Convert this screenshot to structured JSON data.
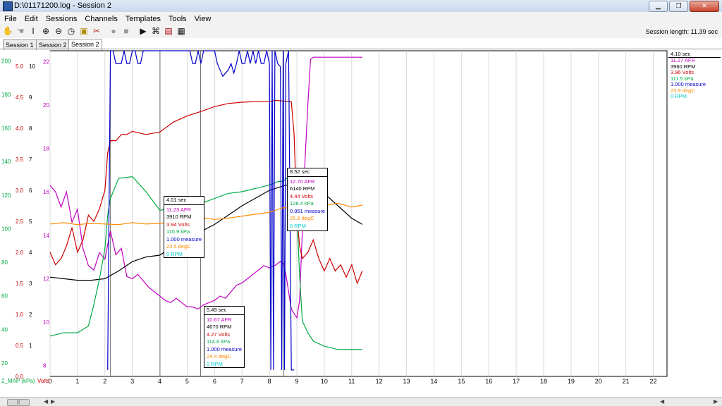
{
  "window": {
    "title": "D:\\01171200.log - Session 2",
    "minimize": "▁",
    "maximize": "❐",
    "close": "✕"
  },
  "menu": [
    "File",
    "Edit",
    "Sessions",
    "Channels",
    "Templates",
    "Tools",
    "View"
  ],
  "toolbar_icons": [
    "hand-icon",
    "pan-icon",
    "cursor-icon",
    "zoom-in-icon",
    "zoom-out-icon",
    "clock-icon",
    "marker-icon",
    "mark-clear-icon",
    "record-icon",
    "stop-icon",
    "play-icon",
    "binoculars-icon",
    "chart-icon",
    "table-icon"
  ],
  "session_length": "Session length:  11.39 sec",
  "tabs": [
    "Session 1",
    "Session 2",
    "Session 2"
  ],
  "colors": {
    "afr": "#c000c0",
    "rpm": "#000000",
    "volts": "#cc0000",
    "kpa": "#00aa44",
    "measure": "#0000cc",
    "degc": "#ff8800",
    "rpm2": "#00c8c8"
  },
  "axes": {
    "x_ticks": [
      "0",
      "1",
      "2",
      "3",
      "4",
      "5",
      "6",
      "7",
      "8",
      "9",
      "10",
      "11",
      "12",
      "13",
      "14",
      "15",
      "16",
      "17",
      "18",
      "19",
      "20",
      "21",
      "22"
    ],
    "map_ticks": [
      "200",
      "180",
      "160",
      "140",
      "120",
      "100",
      "80",
      "60",
      "40",
      "20"
    ],
    "volts_ticks": [
      "5.0",
      "4.5",
      "4.0",
      "3.5",
      "3.0",
      "2.5",
      "2.0",
      "1.5",
      "1.0",
      "0.5",
      "0.0"
    ],
    "rpm_ticks": [
      "10",
      "9",
      "8",
      "7",
      "6",
      "5",
      "4",
      "3",
      "2",
      "1"
    ],
    "afr_ticks": [
      "22",
      "20",
      "18",
      "16",
      "14",
      "12",
      "10",
      "8"
    ],
    "bottom_label_map": "2_MAP (kPa)",
    "bottom_label_volts": "Volts"
  },
  "boxes": [
    {
      "time": "4.01 sec",
      "rows": [
        "11.23 AFR",
        "3910 RPM",
        "3.94 Volts",
        "110.9 kPa",
        "1.000 measure",
        "23.5 degC",
        "0 RPM"
      ]
    },
    {
      "time": "5.49 sec",
      "rows": [
        "10.67 AFR",
        "4670 RPM",
        "4.27 Volts",
        "114.6 kPa",
        "1.000 measure",
        "24.4 degC",
        "0 RPM"
      ]
    },
    {
      "time": "8.52 sec",
      "rows": [
        "12.70 AFR",
        "6140 RPM",
        "4.44 Volts",
        "128.4 kPa",
        "0.951 measure",
        "25.9 degC",
        "0 RPM"
      ]
    }
  ],
  "legend": {
    "time": "4.10 sec",
    "rows": [
      "11.27 AFR",
      "3960 RPM",
      "3.96 Volts",
      "111.5 kPa",
      "1.000 measure",
      "23.9 degC",
      "0 RPM"
    ]
  },
  "chart_data": {
    "type": "line",
    "xlim": [
      0,
      22.5
    ],
    "cursors": [
      2.2,
      4.01,
      5.49,
      8.52
    ],
    "series": [
      {
        "name": "AFR",
        "axis": "afr",
        "ylim": [
          7.5,
          22.5
        ],
        "x": [
          0,
          0.2,
          0.4,
          0.6,
          0.8,
          1.0,
          1.2,
          1.4,
          1.6,
          1.8,
          2.0,
          2.2,
          2.4,
          2.6,
          2.8,
          3.0,
          3.2,
          3.4,
          3.6,
          3.8,
          4.0,
          4.2,
          4.4,
          4.6,
          4.8,
          5.0,
          5.2,
          5.4,
          5.6,
          5.8,
          6.0,
          6.2,
          6.4,
          6.6,
          6.8,
          7.0,
          7.2,
          7.4,
          7.6,
          7.8,
          8.0,
          8.2,
          8.4,
          8.5,
          8.6,
          8.8,
          9.0,
          9.1,
          9.2,
          9.3,
          9.4,
          9.5,
          9.6,
          9.8,
          10.0,
          10.5,
          11.0,
          11.39
        ],
        "y": [
          16.3,
          16.0,
          15.3,
          16.0,
          14.6,
          15.2,
          13.4,
          12.6,
          12.4,
          13.2,
          12.9,
          14.2,
          13.1,
          13.4,
          12.1,
          12.0,
          12.2,
          11.9,
          11.6,
          11.4,
          11.2,
          11.0,
          10.9,
          11.1,
          10.9,
          10.7,
          10.7,
          10.6,
          10.8,
          10.9,
          11.0,
          11.2,
          11.1,
          11.4,
          11.7,
          11.8,
          12.0,
          12.2,
          12.4,
          12.6,
          12.5,
          12.6,
          12.8,
          12.7,
          12.2,
          10.6,
          10.2,
          11.0,
          14.2,
          17.5,
          20.0,
          22.1,
          22.2,
          22.2,
          22.2,
          22.2,
          22.2,
          22.2
        ]
      },
      {
        "name": "RPM",
        "axis": "rpm",
        "ylim": [
          0,
          10.5
        ],
        "x": [
          0,
          0.5,
          1.0,
          1.5,
          2.0,
          2.5,
          3.0,
          3.5,
          4.0,
          4.5,
          5.0,
          5.5,
          6.0,
          6.5,
          7.0,
          7.5,
          8.0,
          8.5,
          8.8,
          9.0,
          9.5,
          10.0,
          10.5,
          11.0,
          11.39
        ],
        "y": [
          3.2,
          3.15,
          3.1,
          3.1,
          3.15,
          3.4,
          3.7,
          3.85,
          3.91,
          4.2,
          4.45,
          4.67,
          4.9,
          5.2,
          5.5,
          5.75,
          6.0,
          6.14,
          6.2,
          6.25,
          6.3,
          5.9,
          5.5,
          5.1,
          4.9
        ]
      },
      {
        "name": "Volts",
        "axis": "volts",
        "ylim": [
          0,
          5.25
        ],
        "x": [
          0,
          0.2,
          0.4,
          0.6,
          0.8,
          1.0,
          1.2,
          1.4,
          1.6,
          1.8,
          2.0,
          2.1,
          2.2,
          2.4,
          2.6,
          2.8,
          3.0,
          3.5,
          4.0,
          4.5,
          5.0,
          5.5,
          6.0,
          6.5,
          7.0,
          7.5,
          8.0,
          8.2,
          8.5,
          8.8,
          8.9,
          9.0,
          9.1,
          9.2,
          9.4,
          9.6,
          9.8,
          10.0,
          10.2,
          10.4,
          10.6,
          10.8,
          11.0,
          11.2,
          11.39
        ],
        "y": [
          2.0,
          1.8,
          1.9,
          2.1,
          2.4,
          2.0,
          2.2,
          2.6,
          2.5,
          2.7,
          3.0,
          3.6,
          3.8,
          3.8,
          3.9,
          3.9,
          3.95,
          3.9,
          3.94,
          4.1,
          4.2,
          4.27,
          4.35,
          4.4,
          4.42,
          4.43,
          4.43,
          4.45,
          4.44,
          4.43,
          3.9,
          2.6,
          2.1,
          1.9,
          2.0,
          2.2,
          1.9,
          1.7,
          1.9,
          1.7,
          1.8,
          1.6,
          1.8,
          1.5,
          1.7
        ]
      },
      {
        "name": "kPa",
        "axis": "map",
        "ylim": [
          12,
          206
        ],
        "x": [
          0,
          0.5,
          1.0,
          1.4,
          1.6,
          1.8,
          2.0,
          2.1,
          2.2,
          2.5,
          3.0,
          3.5,
          4.0,
          4.5,
          5.0,
          5.5,
          6.0,
          6.5,
          7.0,
          7.5,
          8.0,
          8.3,
          8.52,
          8.7,
          8.8,
          8.9,
          9.0,
          9.1,
          9.2,
          9.4,
          9.6,
          10.0,
          10.5,
          11.0,
          11.39
        ],
        "y": [
          36,
          38,
          38,
          42,
          55,
          70,
          88,
          108,
          118,
          130,
          131,
          122,
          111,
          112,
          112,
          115,
          118,
          121,
          122,
          124,
          126,
          128,
          128.4,
          131,
          128,
          125,
          110,
          72,
          45,
          38,
          33,
          30,
          28,
          28,
          28
        ]
      },
      {
        "name": "measure",
        "axis": "measure",
        "ylim": [
          -0.02,
          1.0
        ],
        "x": [
          2.1,
          2.2,
          2.3,
          2.4,
          2.5,
          2.6,
          2.7,
          2.8,
          2.9,
          3.0,
          3.1,
          3.2,
          3.3,
          3.4,
          3.5,
          3.6,
          3.7,
          3.8,
          3.9,
          4.0,
          4.2,
          4.4,
          4.6,
          4.8,
          5.0,
          5.1,
          5.2,
          5.3,
          5.4,
          5.5,
          5.6,
          5.7,
          5.8,
          5.9,
          6.0,
          6.1,
          6.2,
          6.3,
          6.4,
          6.5,
          6.6,
          6.7,
          6.8,
          6.9,
          7.0,
          7.1,
          7.2,
          7.3,
          7.4,
          7.5,
          7.6,
          7.7,
          7.8,
          7.9,
          8.0,
          8.05,
          8.1,
          8.15,
          8.2,
          8.3,
          8.4,
          8.45,
          8.5,
          8.55,
          8.6,
          8.7,
          8.8,
          8.85,
          8.9
        ],
        "y": [
          0,
          1.0,
          1.0,
          0.96,
          0.96,
          0.96,
          1.0,
          0.96,
          0.96,
          1.0,
          1.0,
          0.96,
          0.96,
          1.0,
          1.0,
          1.0,
          1.0,
          1.0,
          1.0,
          1.0,
          1.0,
          1.0,
          1.0,
          1.0,
          1.0,
          1.0,
          0.96,
          0.96,
          1.0,
          0.96,
          1.0,
          1.0,
          1.0,
          1.0,
          1.0,
          0.96,
          0.94,
          0.92,
          0.93,
          0.94,
          0.96,
          0.93,
          0.96,
          1.0,
          0.96,
          0.96,
          1.0,
          0.96,
          1.0,
          0.96,
          1.0,
          0.96,
          0.96,
          1.0,
          0.96,
          0.0,
          1.0,
          0.0,
          1.0,
          0.96,
          0.95,
          0.0,
          1.0,
          0.0,
          0.96,
          1.0,
          0.0,
          0.0,
          0.0
        ]
      },
      {
        "name": "degC",
        "axis": "degc",
        "ylim": [
          0,
          50
        ],
        "x": [
          0,
          0.5,
          1.0,
          1.5,
          2.0,
          2.5,
          3.0,
          3.5,
          4.0,
          4.5,
          5.0,
          5.5,
          6.0,
          6.5,
          7.0,
          7.5,
          8.0,
          8.5,
          9.0,
          9.5,
          10.0,
          10.5,
          11.0,
          11.39
        ],
        "y": [
          23.4,
          23.6,
          23.3,
          23.5,
          23.4,
          23.3,
          23.6,
          23.4,
          23.5,
          23.7,
          24.0,
          24.4,
          24.1,
          24.3,
          24.6,
          24.9,
          25.2,
          25.9,
          25.8,
          26.4,
          26.2,
          26.6,
          26.0,
          26.3
        ]
      }
    ]
  }
}
